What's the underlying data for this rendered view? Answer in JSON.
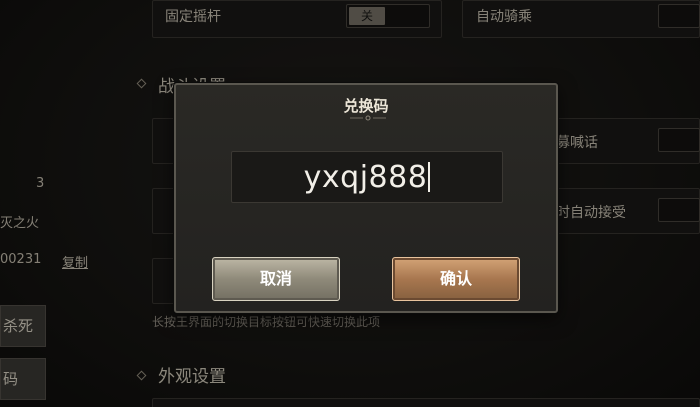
{
  "settings": {
    "row1_left_label": "固定摇杆",
    "row1_toggle": "关",
    "row1_right_label": "自动骑乘",
    "section_battle": "战斗设置",
    "row2_right_label": "募喊话",
    "row3_right_label": "时自动接受",
    "hint": "长按王界面的切换目标按钮可快速切换此项",
    "section_appearance": "外观设置"
  },
  "left_panel": {
    "value_3": "3",
    "name": "灭之火",
    "id": "00231",
    "copy": "复制",
    "btn1": "杀死",
    "btn2": "码"
  },
  "dialog": {
    "title": "兑换码",
    "code_value": "yxqj888",
    "cancel_label": "取消",
    "confirm_label": "确认"
  }
}
